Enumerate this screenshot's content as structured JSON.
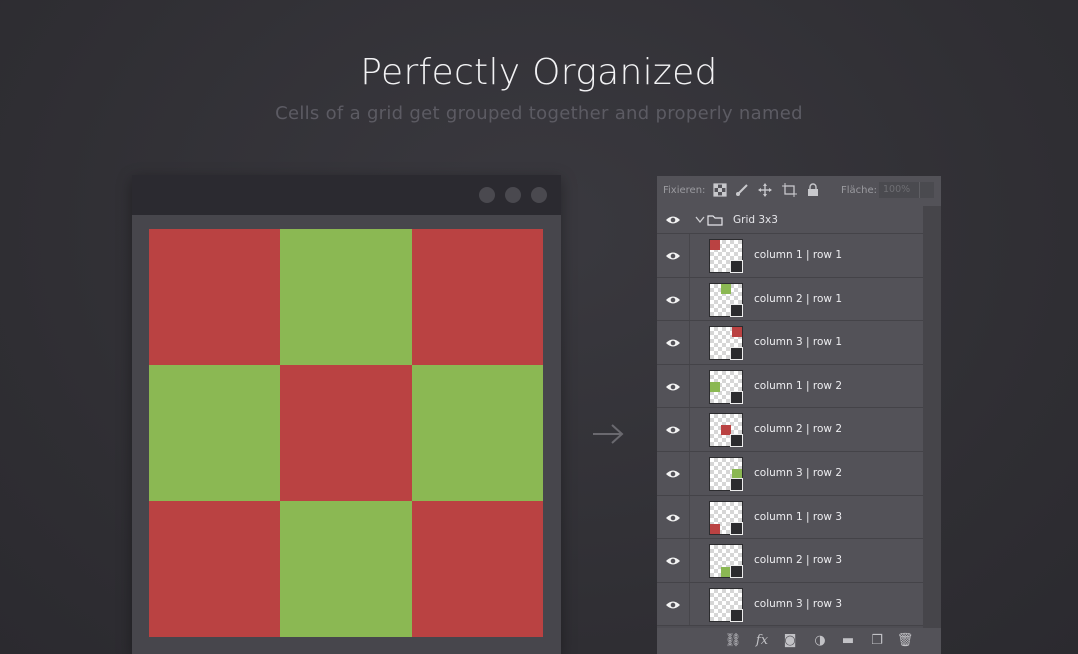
{
  "hero": {
    "title": "Perfectly Organized",
    "subtitle": "Cells of a grid get grouped together and properly named"
  },
  "colors": {
    "red": "#ba4242",
    "green": "#8bb853"
  },
  "grid": [
    [
      "red",
      "green",
      "red"
    ],
    [
      "green",
      "red",
      "green"
    ],
    [
      "red",
      "green",
      "red"
    ]
  ],
  "layers_panel": {
    "lock_label": "Fixieren:",
    "fill_label": "Fläche:",
    "fill_value": "100%",
    "group_name": "Grid 3x3",
    "layers": [
      {
        "label": "column 1 | row 1",
        "color": "red",
        "col": 1,
        "row": 1
      },
      {
        "label": "column 2 | row 1",
        "color": "green",
        "col": 2,
        "row": 1
      },
      {
        "label": "column 3 | row 1",
        "color": "red",
        "col": 3,
        "row": 1
      },
      {
        "label": "column 1 | row 2",
        "color": "green",
        "col": 1,
        "row": 2
      },
      {
        "label": "column 2 | row 2",
        "color": "red",
        "col": 2,
        "row": 2
      },
      {
        "label": "column 3 | row 2",
        "color": "green",
        "col": 3,
        "row": 2
      },
      {
        "label": "column 1 | row 3",
        "color": "red",
        "col": 1,
        "row": 3
      },
      {
        "label": "column 2 | row 3",
        "color": "green",
        "col": 2,
        "row": 3
      },
      {
        "label": "column 3 | row 3",
        "color": "red",
        "col": 3,
        "row": 3
      }
    ],
    "bottom_icons": [
      "link-icon",
      "fx-icon",
      "mask-icon",
      "adjustment-icon",
      "folder-icon",
      "new-layer-icon",
      "trash-icon"
    ]
  }
}
